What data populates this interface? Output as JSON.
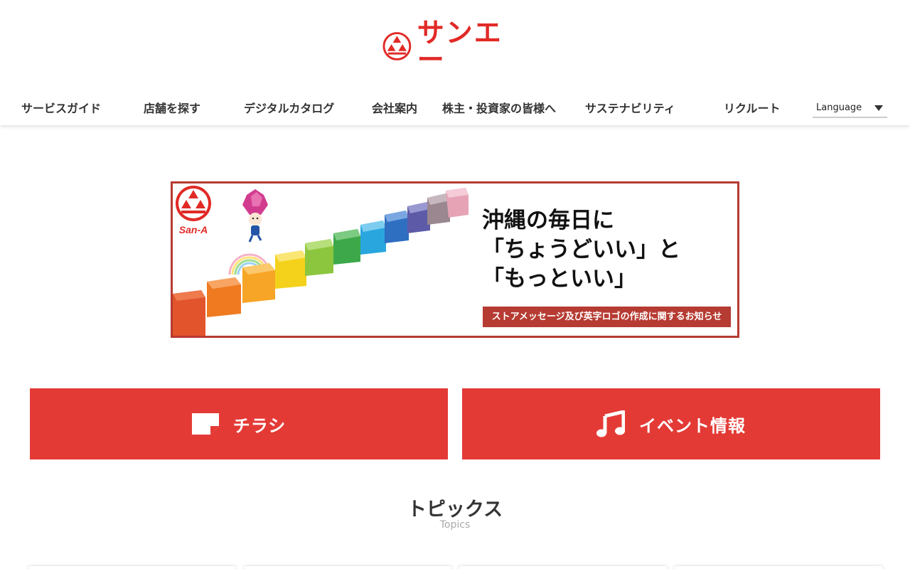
{
  "header": {
    "logo_text": "サンエー",
    "nav": [
      "サービスガイド",
      "店舗を探す",
      "デジタルカタログ",
      "会社案内",
      "株主・投資家の皆様へ",
      "サステナビリティ",
      "リクルート"
    ],
    "language_label": "Language"
  },
  "banner": {
    "copy_lines": [
      "沖縄の毎日に",
      "「ちょうどいい」と",
      "「もっといい」"
    ],
    "notice": "ストアメッセージ及び英字ロゴの作成に関するお知らせ",
    "brand_mark_text": "San-A"
  },
  "buttons": {
    "flyer_label": "チラシ",
    "event_label": "イベント情報"
  },
  "topics": {
    "title": "トピックス",
    "subtitle": "Topics"
  },
  "colors": {
    "brand_red": "#e12a26",
    "button_red": "#e43a36",
    "banner_border": "#b63b32"
  },
  "icons": {
    "flyer": "flyer-icon",
    "event": "music-note-icon",
    "language": "chevron-down-icon"
  }
}
